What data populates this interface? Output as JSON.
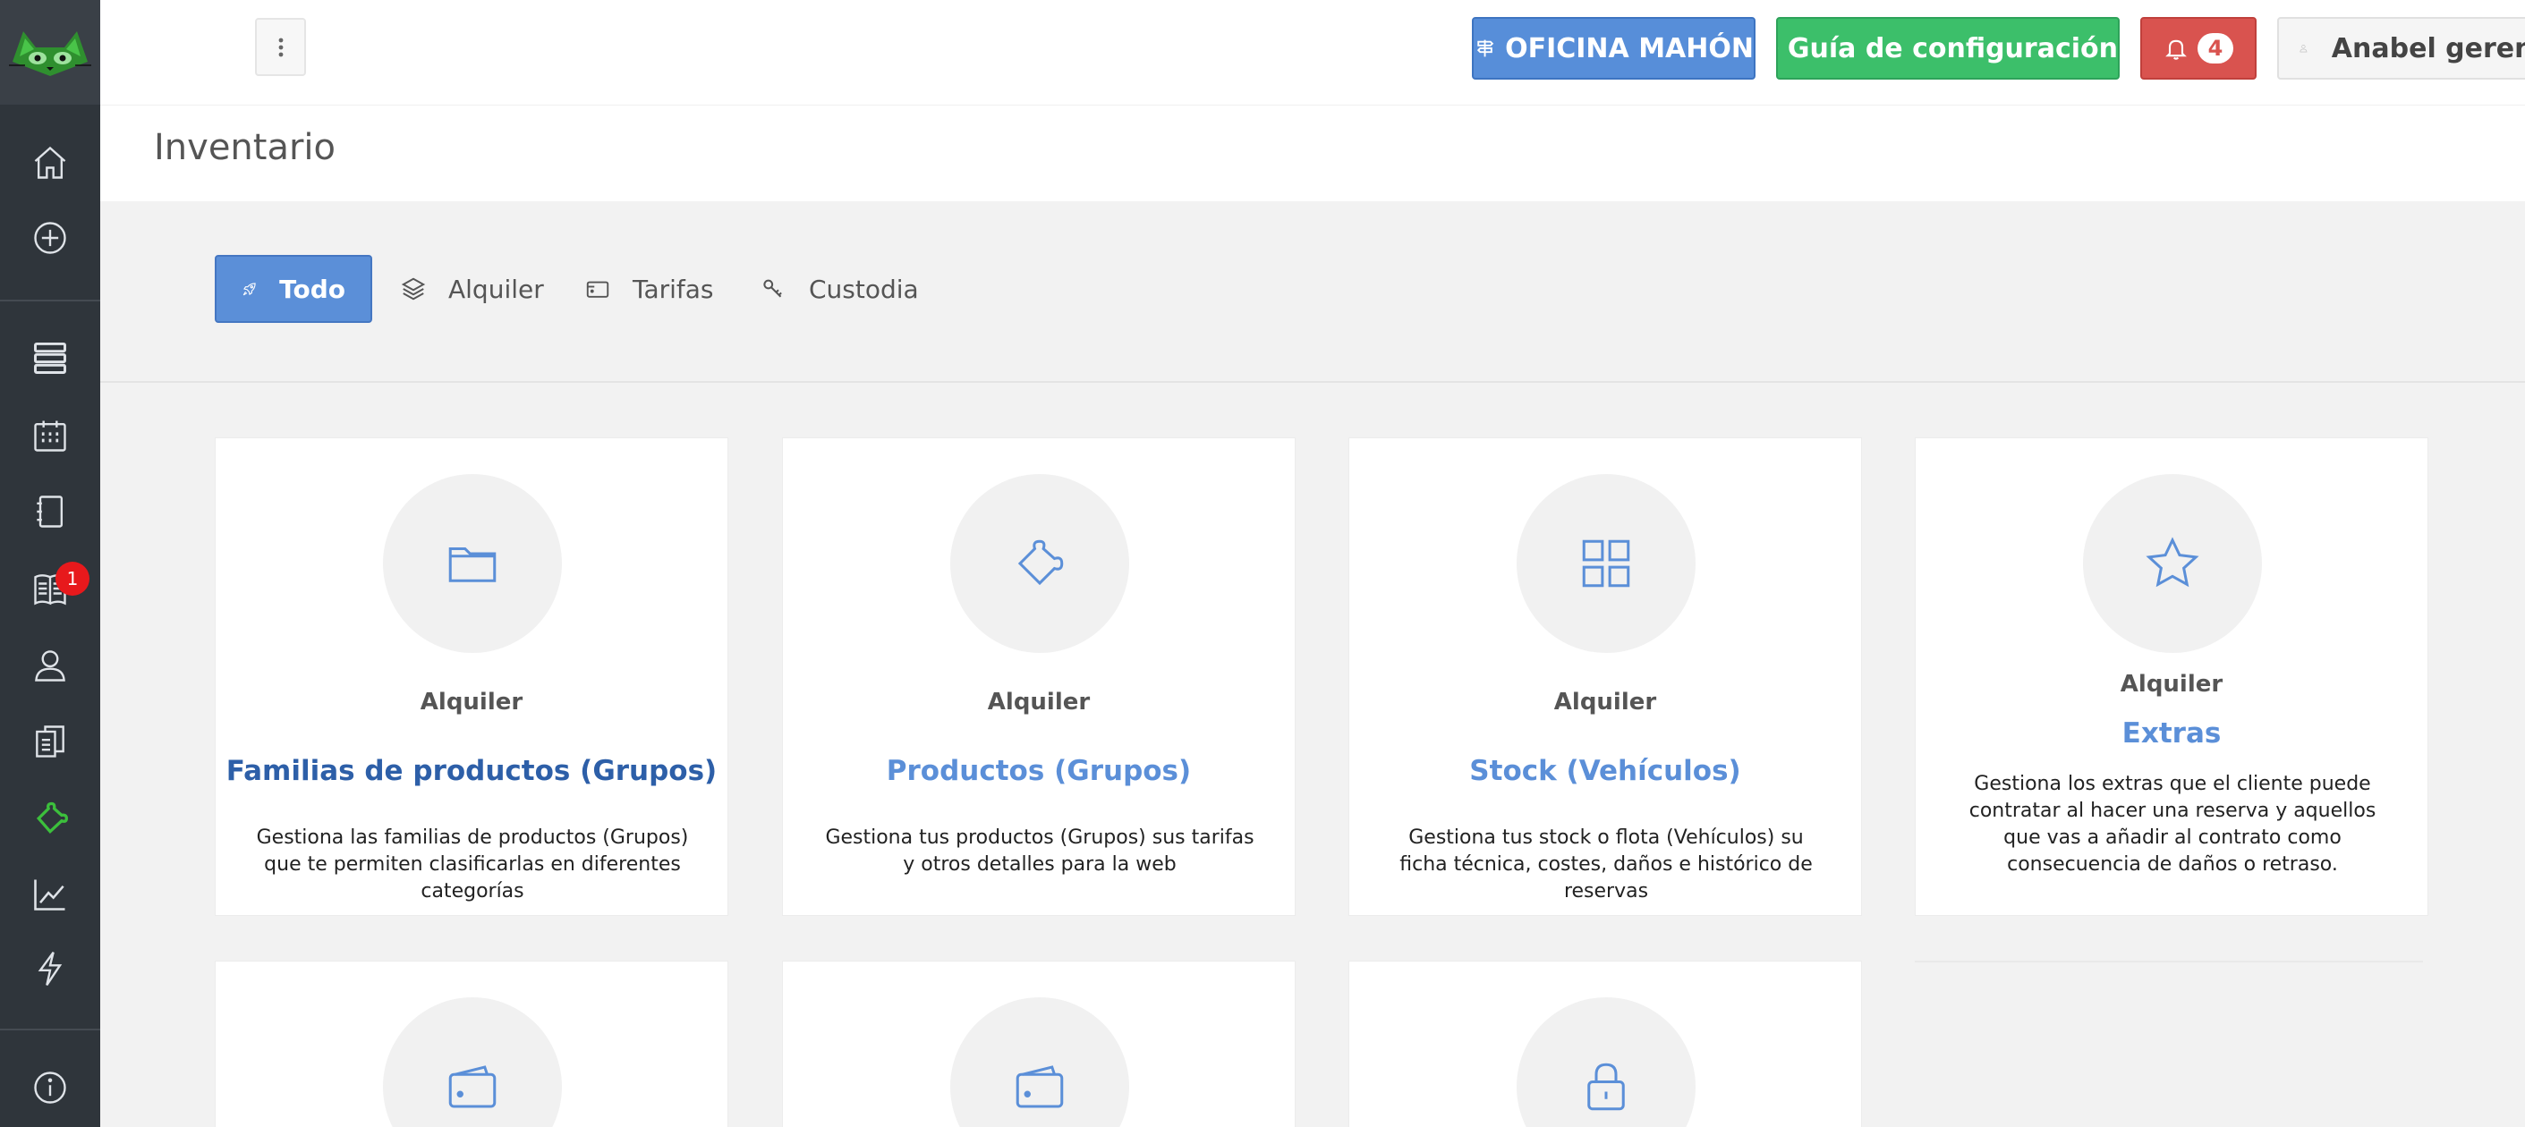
{
  "header": {
    "office_button": "OFICINA MAHÓN",
    "guide_button": "Guía de configuración",
    "notifications_count": "4",
    "user_name": "Anabel gerencia"
  },
  "sidebar": {
    "items": [
      {
        "icon": "home-icon"
      },
      {
        "icon": "add-circle-icon"
      },
      {
        "icon": "server-icon"
      },
      {
        "icon": "calendar-icon"
      },
      {
        "icon": "notebook-icon"
      },
      {
        "icon": "ledger-icon",
        "badge": "1"
      },
      {
        "icon": "customers-icon"
      },
      {
        "icon": "documents-icon"
      },
      {
        "icon": "inventory-icon",
        "active": true
      },
      {
        "icon": "stats-chart-icon"
      },
      {
        "icon": "lightning-icon"
      },
      {
        "icon": "info-icon"
      }
    ],
    "active_color": "#3cbf3c"
  },
  "page": {
    "title": "Inventario"
  },
  "tabs": [
    {
      "label": "Todo",
      "icon": "rocket-icon",
      "active": true
    },
    {
      "label": "Alquiler",
      "icon": "layers-icon"
    },
    {
      "label": "Tarifas",
      "icon": "card-icon"
    },
    {
      "label": "Custodia",
      "icon": "key-icon"
    }
  ],
  "cards": [
    {
      "category": "Alquiler",
      "title": "Familias de productos (Grupos)",
      "description": "Gestiona las familias de productos (Grupos) que te permiten clasificarlas en diferentes categorías",
      "icon": "folder-icon"
    },
    {
      "category": "Alquiler",
      "title": "Productos (Grupos)",
      "description": "Gestiona tus productos (Grupos) sus tarifas y otros detalles para la web",
      "icon": "puzzle-icon"
    },
    {
      "category": "Alquiler",
      "title": "Stock (Vehículos)",
      "description": "Gestiona tus stock o flota (Vehículos) su ficha técnica, costes, daños e histórico de reservas",
      "icon": "grid-icon"
    },
    {
      "category": "Alquiler",
      "title": "Extras",
      "description": "Gestiona los extras que el cliente puede contratar al hacer una reserva y aquellos que vas a añadir al contrato como consecuencia de daños o retraso.",
      "icon": "star-icon"
    },
    {
      "icon": "wallet-icon"
    },
    {
      "icon": "wallet-icon"
    },
    {
      "icon": "lock-icon"
    }
  ],
  "colors": {
    "primary": "#5b8fd8",
    "success": "#3cbf6a",
    "danger": "#d9534f",
    "sidebar_bg": "#2f353b"
  }
}
